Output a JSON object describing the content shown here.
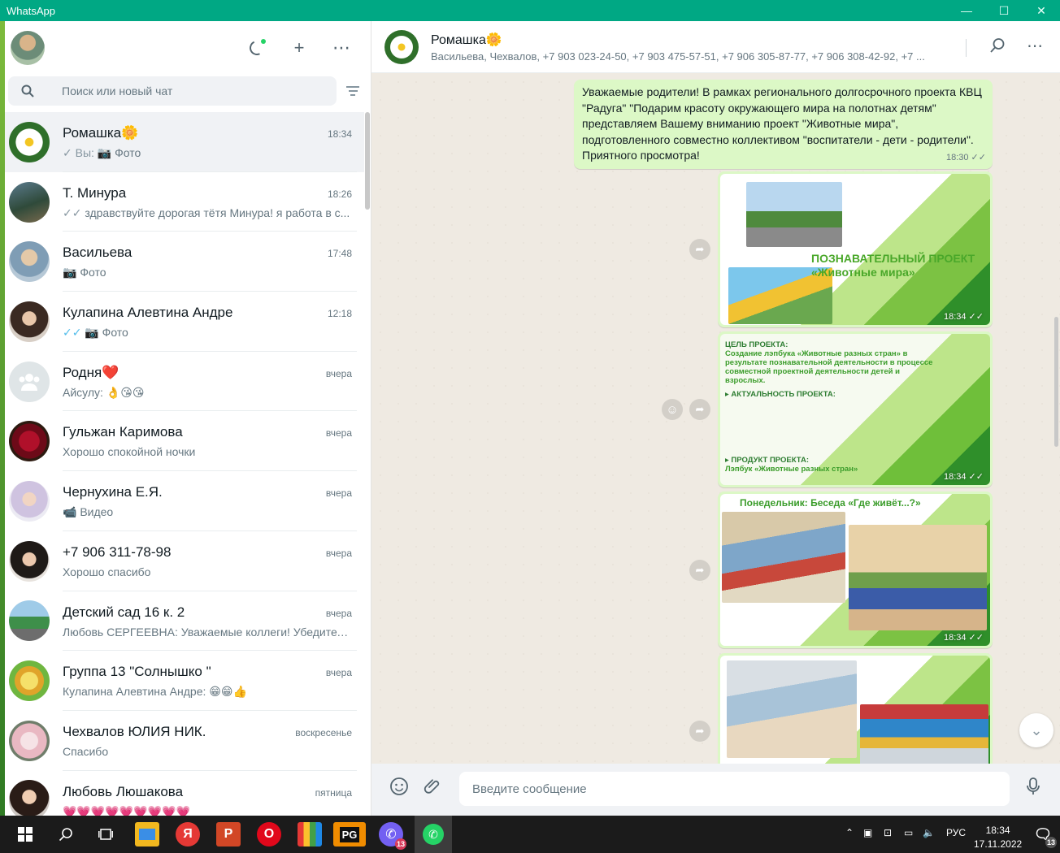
{
  "window": {
    "title": "WhatsApp",
    "controls": [
      "—",
      "☐",
      "✕"
    ]
  },
  "sidebar": {
    "search_placeholder": "Поиск или новый чат",
    "chats": [
      {
        "name": "Ромашка",
        "name_emoji": "🌼",
        "time": "18:34",
        "preview_prefix": "✓ Вы: ",
        "preview": "📷 Фото",
        "tick": "grey"
      },
      {
        "name": "Т. Минура",
        "time": "18:26",
        "preview_prefix": "✓✓ ",
        "preview": "здравствуйте дорогая тётя Минура! я работа в с...",
        "tick": "grey"
      },
      {
        "name": "Васильева",
        "time": "17:48",
        "preview_prefix": "",
        "preview": "📷 Фото"
      },
      {
        "name": "Кулапина Алевтина Андре",
        "time": "12:18",
        "preview_prefix": "✓✓ ",
        "preview": "📷 Фото",
        "tick": "blue"
      },
      {
        "name": "Родня",
        "name_emoji": "❤️",
        "time": "вчера",
        "preview_prefix": "",
        "preview": "Айсулу: 👌😘😘"
      },
      {
        "name": "Гульжан Каримова",
        "time": "вчера",
        "preview_prefix": "",
        "preview": "Хорошо спокойной ночки"
      },
      {
        "name": "Чернухина Е.Я.",
        "time": "вчера",
        "preview_prefix": "",
        "preview": "📹 Видео"
      },
      {
        "name": "+7 906 311-78-98",
        "time": "вчера",
        "preview_prefix": "",
        "preview": "Хорошо спасибо"
      },
      {
        "name": "Детский сад 16 к. 2",
        "time": "вчера",
        "preview_prefix": "",
        "preview": "Любовь СЕРГЕЕВНА: Уважаемые коллеги! Убедител..."
      },
      {
        "name": "Группа 13 \"Солнышко \"",
        "time": "вчера",
        "preview_prefix": "",
        "preview": "Кулапина Алевтина Андре: 😁😁👍"
      },
      {
        "name": "Чехвалов ЮЛИЯ НИК.",
        "time": "воскресенье",
        "preview_prefix": "",
        "preview": "Спасибо"
      },
      {
        "name": "Любовь Люшакова",
        "time": "пятница",
        "preview_prefix": "",
        "preview": "💗💗💗💗💗💗💗💗💗"
      }
    ]
  },
  "conversation": {
    "title": "Ромашка",
    "title_emoji": "🌼",
    "participants": "Васильева, Чехвалов, +7 903 023-24-50, +7 903 475-57-51, +7 906 305-87-77, +7 906 308-42-92, +7 ...",
    "text_message": "Уважаемые родители! В рамках регионального долгосрочного проекта КВЦ \"Радуга\" \"Подарим красоту окружающего мира на полотнах детям\" представляем Вашему вниманию проект \"Животные мира\", подготовленного совместно коллективом \"воспитатели - дети - родители\". Приятного просмотра!",
    "text_time": "18:30 ✓✓",
    "images": [
      {
        "time": "18:34 ✓✓",
        "heading": "ПОЗНАВАТЕЛЬНЫЙ ПРОЕКТ «Животные мира»"
      },
      {
        "time": "18:34 ✓✓",
        "heading": "ЦЕЛЬ ПРОЕКТА:",
        "line1": "Создание лэпбука «Животные разных стран» в результате познавательной деятельности в процессе совместной проектной деятельности детей и взрослых.",
        "heading2": "▸ АКТУАЛЬНОСТЬ ПРОЕКТА:",
        "heading3": "▸ ПРОДУКТ ПРОЕКТА:",
        "line3": "Лэпбук «Животные разных стран»"
      },
      {
        "time": "18:34 ✓✓",
        "heading": "Понедельник: Беседа «Где живёт...?»"
      },
      {
        "time": ""
      }
    ],
    "composer_placeholder": "Введите сообщение"
  },
  "taskbar": {
    "lang": "РУС",
    "time": "18:34",
    "date": "17.11.2022",
    "viber_badge": "13",
    "notif_badge": "13"
  }
}
